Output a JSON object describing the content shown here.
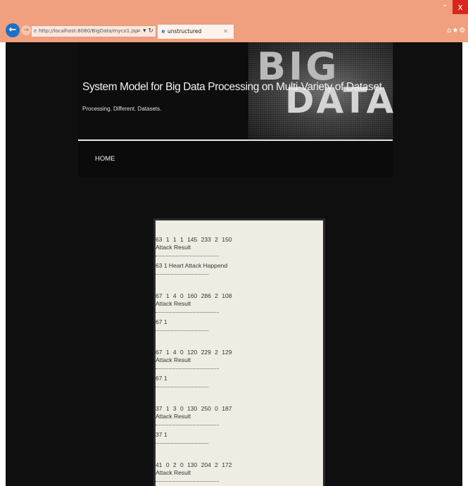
{
  "browser": {
    "address": "http://localhost:8080/BigData/myco1.jsp",
    "address_host": "localhost",
    "tab_title": "unstructured",
    "win_min": "-",
    "win_close": "x"
  },
  "site": {
    "title": "System Model for Big Data Processing on Multi-Variety of Dataset",
    "tagline": "Processing. Different. Datasets.",
    "banner_word1": "BIG",
    "banner_word2": "DATA"
  },
  "nav": {
    "home": "HOME"
  },
  "records": [
    {
      "values": "63 1 1 1 145 233 2 150",
      "label": "Attack Result",
      "result": "63 1 Heart Attack Happend"
    },
    {
      "values": "67 1 4 0 160 286 2 108",
      "label": "Attack Result",
      "result": "67 1"
    },
    {
      "values": "67 1 4 0 120 229 2 129",
      "label": "Attack Result",
      "result": "67 1"
    },
    {
      "values": "37 1 3 0 130 250 0 187",
      "label": "Attack Result",
      "result": "37 1"
    },
    {
      "values": "41 0 2 0 130 204 2 172",
      "label": "Attack Result",
      "result": ""
    }
  ]
}
